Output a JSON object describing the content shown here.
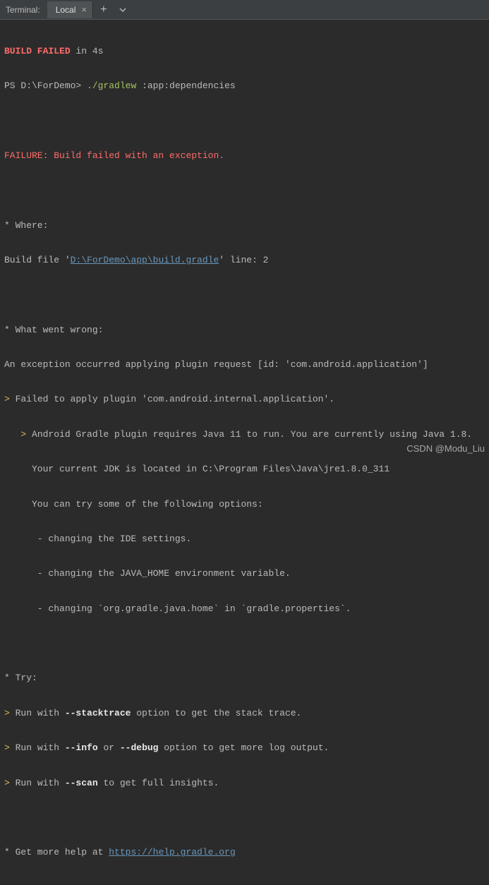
{
  "tab_bar": {
    "panel_label": "Terminal:",
    "tabs": [
      {
        "label": "Local"
      }
    ]
  },
  "terminal": {
    "build_failed_prefix": "BUILD FAILED",
    "build_failed_suffix": " in 4s",
    "prompt": "PS D:\\ForDemo> ",
    "command": "./gradlew",
    "command_args": " :app:dependencies",
    "failure_line": "FAILURE: Build failed with an exception.",
    "where_header": "* Where:",
    "build_file_prefix": "Build file '",
    "build_file_path": "D:\\ForDemo\\app\\build.gradle",
    "build_file_suffix": "' line: 2",
    "wrong_header": "* What went wrong:",
    "exception_line": "An exception occurred applying plugin request [id: 'com.android.application']",
    "gt1": "> ",
    "failed_plugin": "Failed to apply plugin 'com.android.internal.application'.",
    "gt2": "   > ",
    "java_req": "Android Gradle plugin requires Java 11 to run. You are currently using Java 1.8.",
    "jdk_loc": "     Your current JDK is located in C:\\Program Files\\Java\\jre1.8.0_311",
    "try_options": "     You can try some of the following options:",
    "opt1": "      - changing the IDE settings.",
    "opt2": "      - changing the JAVA_HOME environment variable.",
    "opt3": "      - changing `org.gradle.java.home` in `gradle.properties`.",
    "try_header": "* Try:",
    "run_with": "Run with ",
    "stacktrace_flag": "--stacktrace",
    "stacktrace_suffix": " option to get the stack trace.",
    "info_flag": "--info",
    "or_text": " or ",
    "debug_flag": "--debug",
    "debug_suffix": " option to get more log output.",
    "scan_flag": "--scan",
    "scan_suffix": " to get full insights.",
    "help_prefix": "* Get more help at ",
    "help_url": "https://help.gradle.org"
  },
  "watermark": "CSDN @Modu_Liu"
}
